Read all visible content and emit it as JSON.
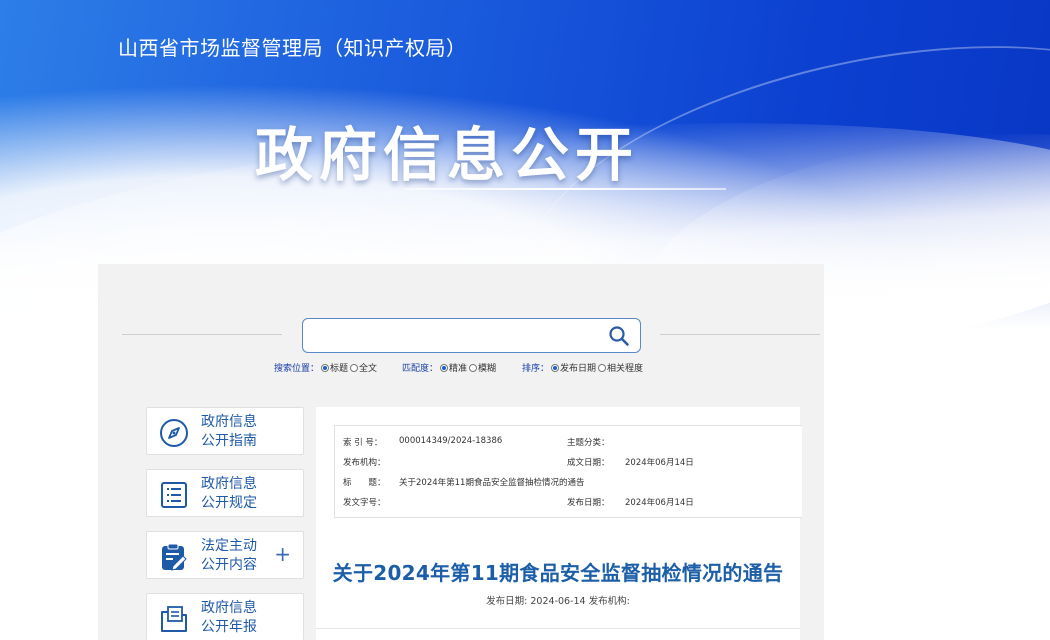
{
  "header": {
    "agency": "山西省市场监督管理局（知识产权局）",
    "title": "政府信息公开"
  },
  "search": {
    "value": "",
    "placeholder": "",
    "options": {
      "position": {
        "label": "搜索位置：",
        "choices": [
          "标题",
          "全文"
        ],
        "selected": "标题"
      },
      "match": {
        "label": "匹配度：",
        "choices": [
          "精准",
          "模糊"
        ],
        "selected": "精准"
      },
      "sort": {
        "label": "排序：",
        "choices": [
          "发布日期",
          "相关程度"
        ],
        "selected": "发布日期"
      }
    }
  },
  "sidebar": {
    "items": [
      {
        "line1": "政府信息",
        "line2": "公开指南",
        "icon": "compass-icon",
        "expandable": false
      },
      {
        "line1": "政府信息",
        "line2": "公开规定",
        "icon": "list-document-icon",
        "expandable": false
      },
      {
        "line1": "法定主动",
        "line2": "公开内容",
        "icon": "clipboard-edit-icon",
        "expandable": true,
        "expand_symbol": "+"
      },
      {
        "line1": "政府信息",
        "line2": "公开年报",
        "icon": "folder-document-icon",
        "expandable": false
      }
    ]
  },
  "meta": {
    "index_no_label": "索 引 号：",
    "index_no": "000014349/2024-18386",
    "topic_label": "主题分类：",
    "topic": "",
    "publisher_label": "发布机构：",
    "publisher": "",
    "written_date_label": "成文日期：",
    "written_date": "2024年06月14日",
    "title_label": "标　　题：",
    "title": "关于2024年第11期食品安全监督抽检情况的通告",
    "doc_no_label": "发文字号：",
    "doc_no": "",
    "publish_date_label": "发布日期：",
    "publish_date": "2024年06月14日"
  },
  "document": {
    "title": "关于2024年第11期食品安全监督抽检情况的通告",
    "subline": "发布日期: 2024-06-14 发布机构:"
  },
  "colors": {
    "banner_blue": "#1450d8",
    "accent_blue": "#1f5aa8",
    "title_blue": "#1c5fa8",
    "panel_gray": "#f2f2f2"
  }
}
